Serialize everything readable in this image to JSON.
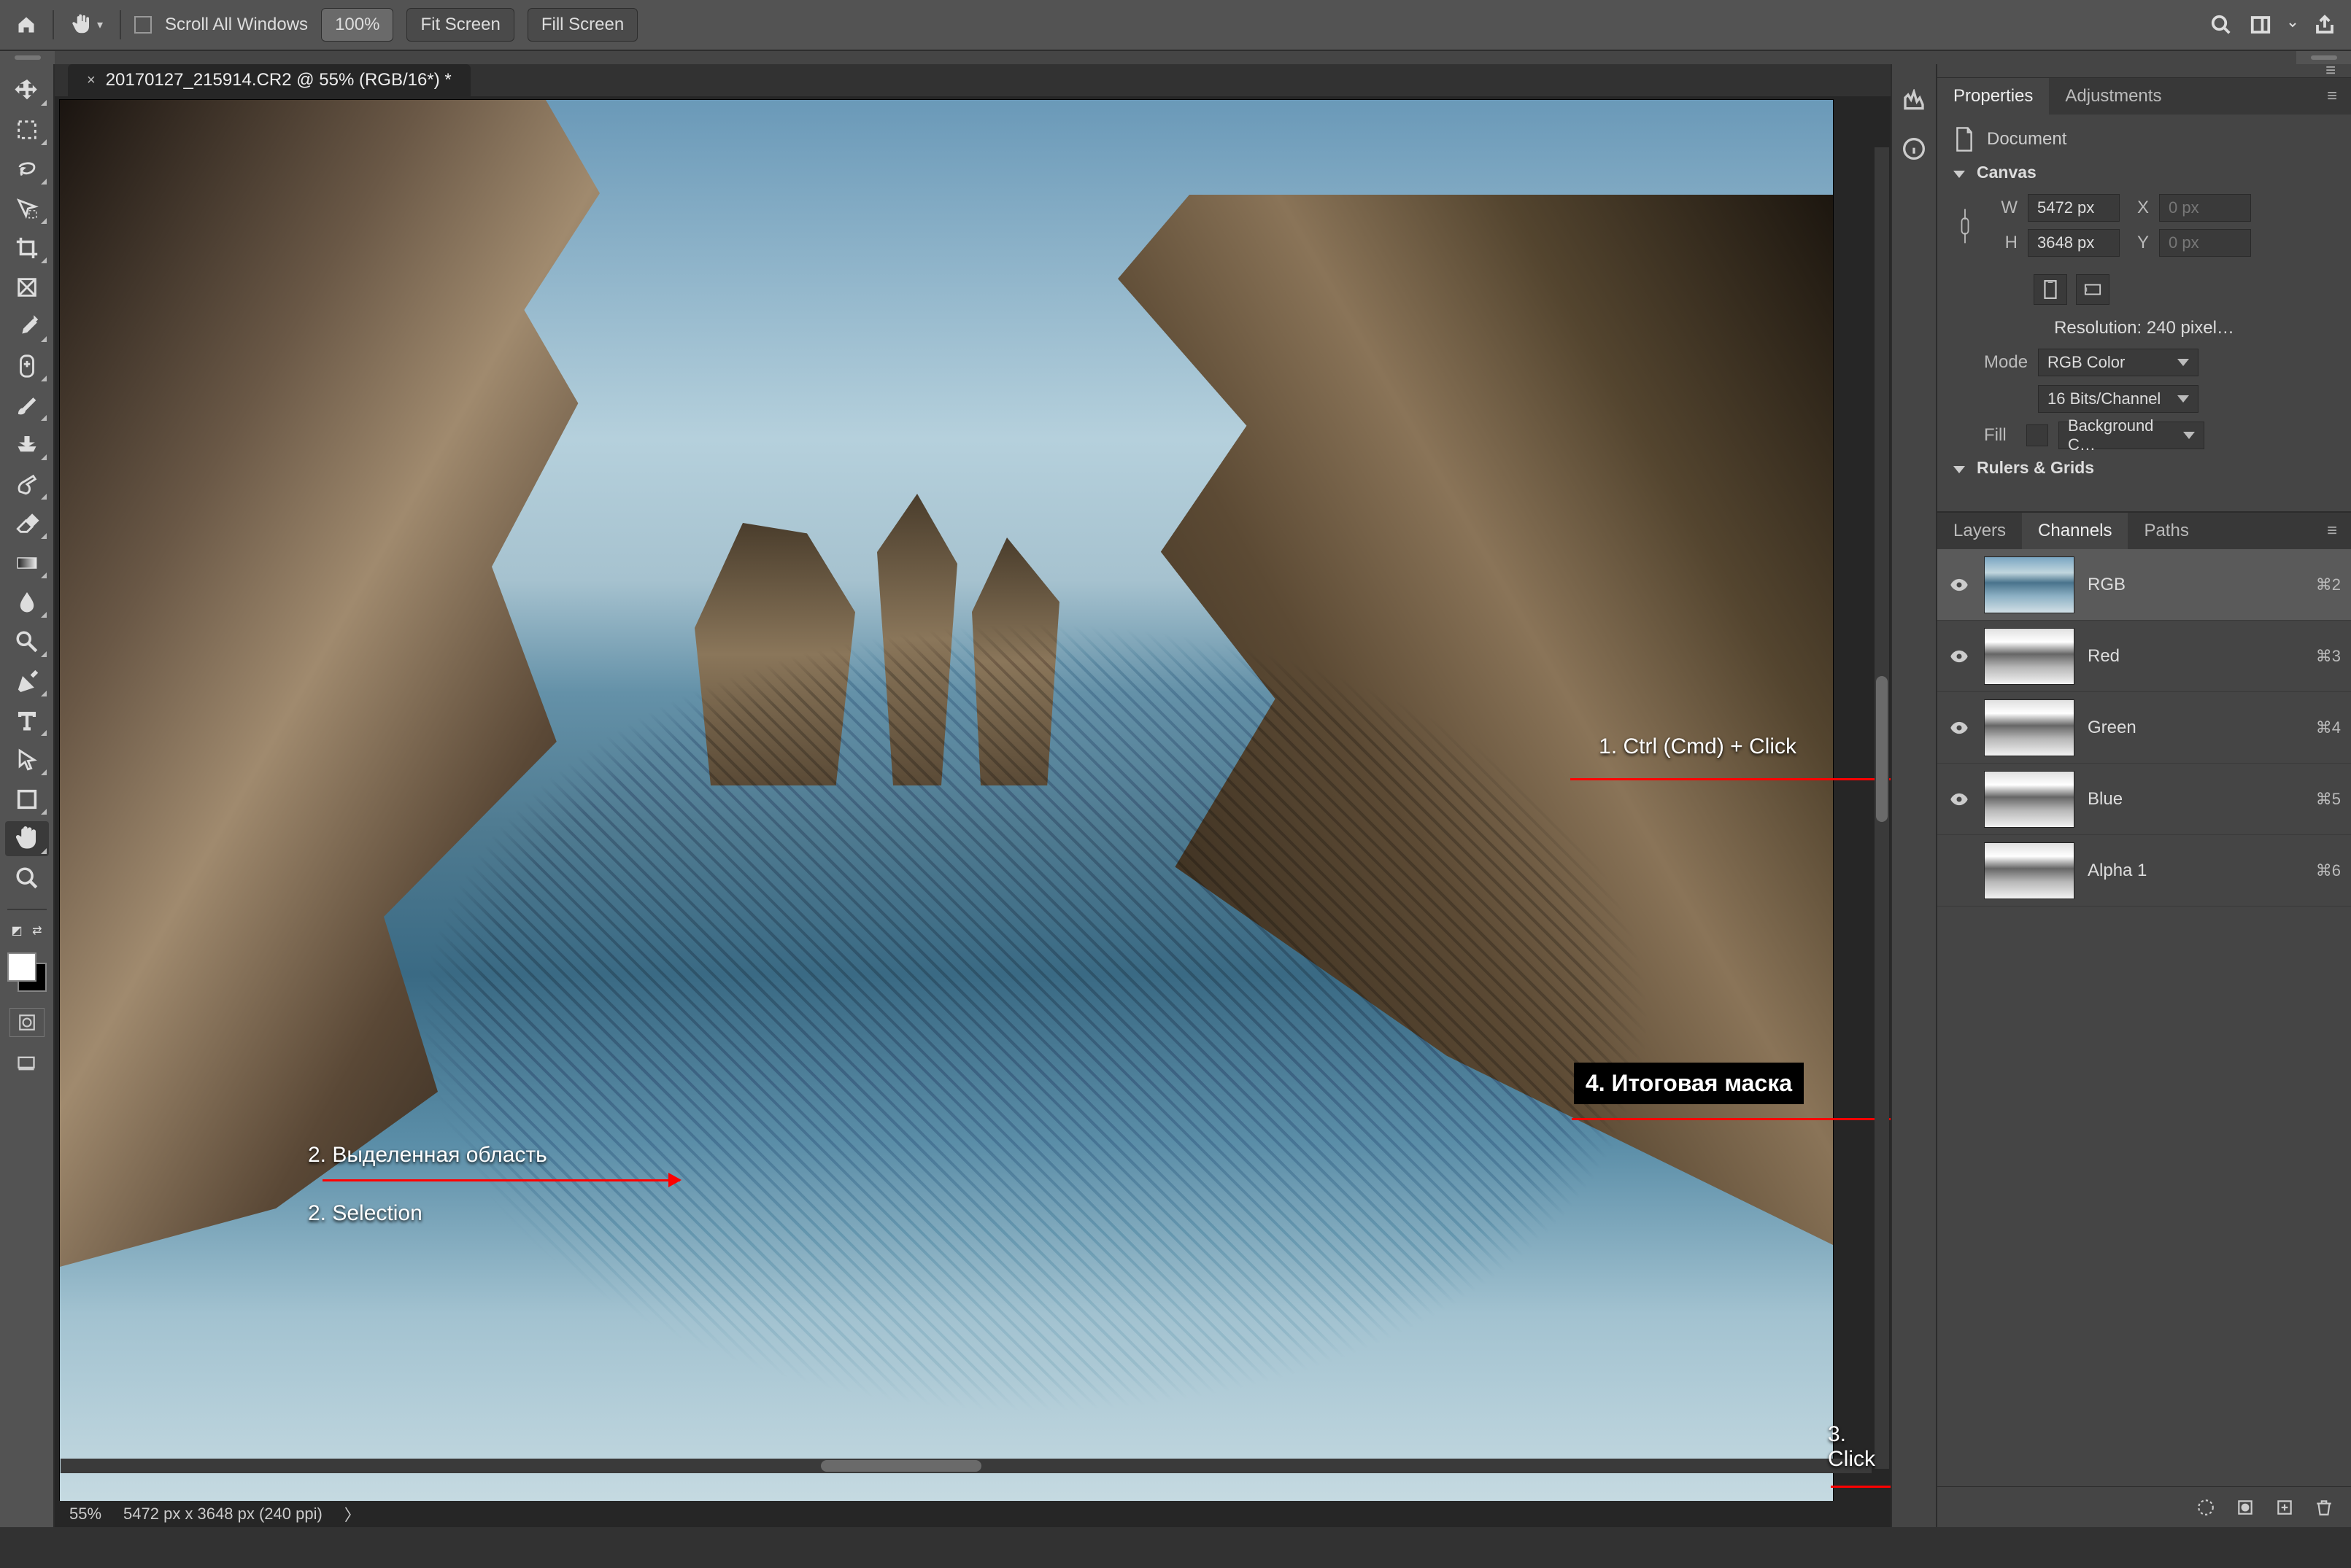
{
  "optbar": {
    "scroll_all": "Scroll All Windows",
    "zoom_100": "100%",
    "fit": "Fit Screen",
    "fill": "Fill Screen"
  },
  "doc_tab": "20170127_215914.CR2 @ 55% (RGB/16*) *",
  "properties": {
    "tab1": "Properties",
    "tab2": "Adjustments",
    "doc_label": "Document",
    "canvas_hdr": "Canvas",
    "W": "W",
    "w_val": "5472 px",
    "H": "H",
    "h_val": "3648 px",
    "X": "X",
    "x_val": "0 px",
    "Y": "Y",
    "y_val": "0 px",
    "resolution": "Resolution: 240 pixel…",
    "mode_lbl": "Mode",
    "mode_val": "RGB Color",
    "depth_val": "16 Bits/Channel",
    "fill_lbl": "Fill",
    "fill_val": "Background C…",
    "rulers_hdr": "Rulers & Grids"
  },
  "panels2": {
    "layers": "Layers",
    "channels": "Channels",
    "paths": "Paths"
  },
  "channels": [
    {
      "name": "RGB",
      "shortcut": "⌘2",
      "vis": true,
      "type": "rgb"
    },
    {
      "name": "Red",
      "shortcut": "⌘3",
      "vis": true,
      "type": "mono"
    },
    {
      "name": "Green",
      "shortcut": "⌘4",
      "vis": true,
      "type": "mono"
    },
    {
      "name": "Blue",
      "shortcut": "⌘5",
      "vis": true,
      "type": "mono"
    },
    {
      "name": "Alpha 1",
      "shortcut": "⌘6",
      "vis": false,
      "type": "mono"
    }
  ],
  "status": {
    "zoom": "55%",
    "dims": "5472 px x 3648 px (240 ppi)"
  },
  "annotations": {
    "a1": "1. Ctrl (Cmd) + Click",
    "a2ru": "2. Выделенная область",
    "a2en": "2. Selection",
    "a3": "3. Click",
    "a4": "4. Итоговая маска"
  }
}
